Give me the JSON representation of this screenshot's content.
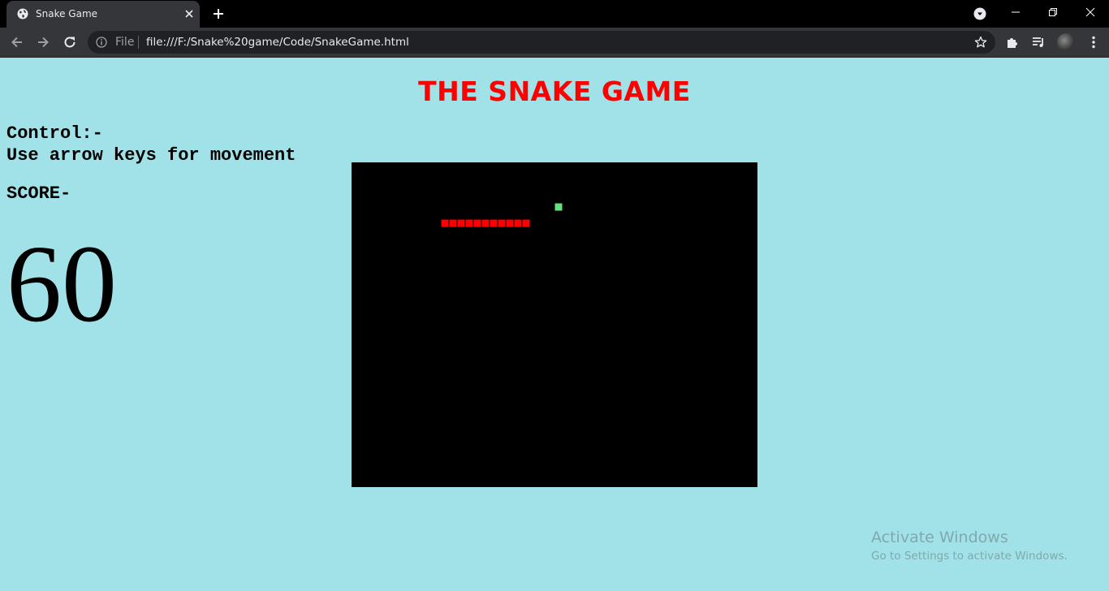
{
  "browser": {
    "tab_title": "Snake Game",
    "address_scheme": "File",
    "address_url": "file:///F:/Snake%20game/Code/SnakeGame.html"
  },
  "page": {
    "title": "THE SNAKE GAME",
    "control_heading": "Control:-",
    "control_text": "Use arrow keys for movement",
    "score_label": "SCORE-",
    "score_value": "60"
  },
  "game": {
    "snake_color": "#ff0000",
    "food_color": "#66e07a",
    "board_color": "#000000",
    "snake_segments": 11
  },
  "os_watermark": {
    "line1": "Activate Windows",
    "line2": "Go to Settings to activate Windows."
  },
  "colors": {
    "page_background": "#a0e2e8",
    "title": "#ff0000"
  }
}
